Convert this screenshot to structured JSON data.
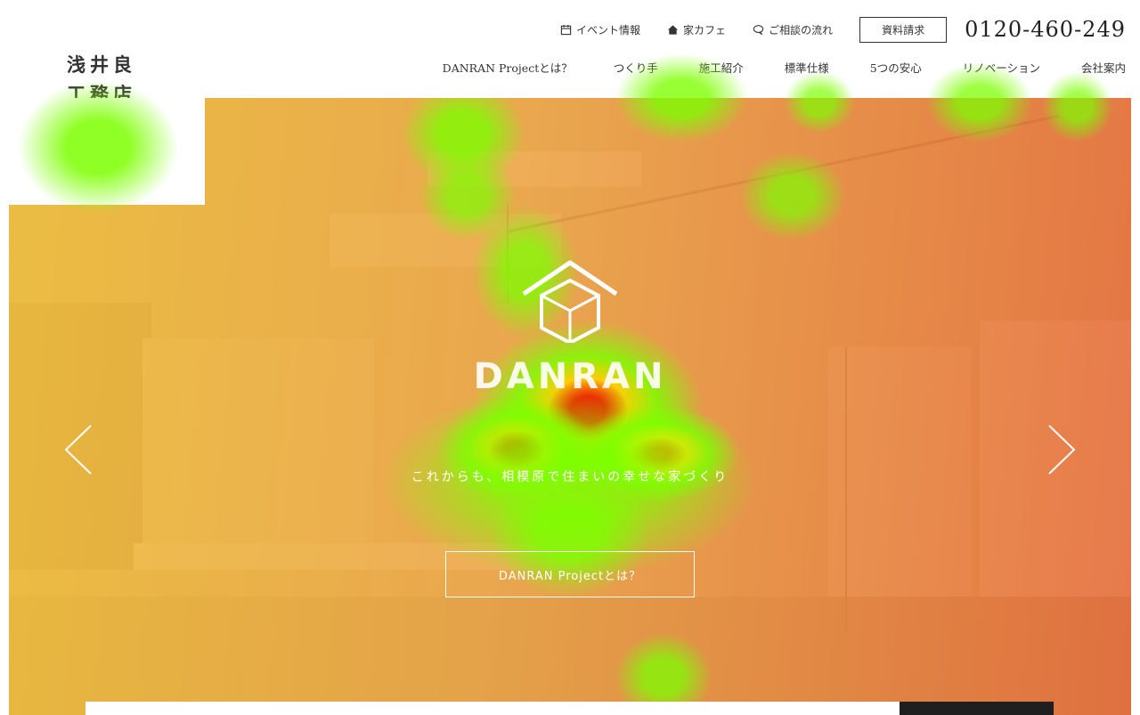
{
  "logo": {
    "line1": "浅井良",
    "line2": "工務店"
  },
  "top_links": [
    {
      "label": "イベント情報",
      "icon": "calendar-icon"
    },
    {
      "label": "家カフェ",
      "icon": "house-icon"
    },
    {
      "label": "ご相談の流れ",
      "icon": "chat-bubble-icon"
    }
  ],
  "doc_request_label": "資料請求",
  "phone": "0120-460-249",
  "nav": [
    "DANRAN Projectとは？",
    "つくり手",
    "施工紹介",
    "標準仕様",
    "5つの安心",
    "リノベーション",
    "会社案内"
  ],
  "hero": {
    "brand": "DANRAN",
    "tagline": "これからも、相模原で住まいの幸せな家づくり",
    "cta_label": "DANRAN Projectとは？"
  },
  "colors": {
    "overlay_start": "#eebe3c",
    "overlay_end": "#e66e3c",
    "heat_green": "#7dff00",
    "heat_red": "#ff0000"
  }
}
